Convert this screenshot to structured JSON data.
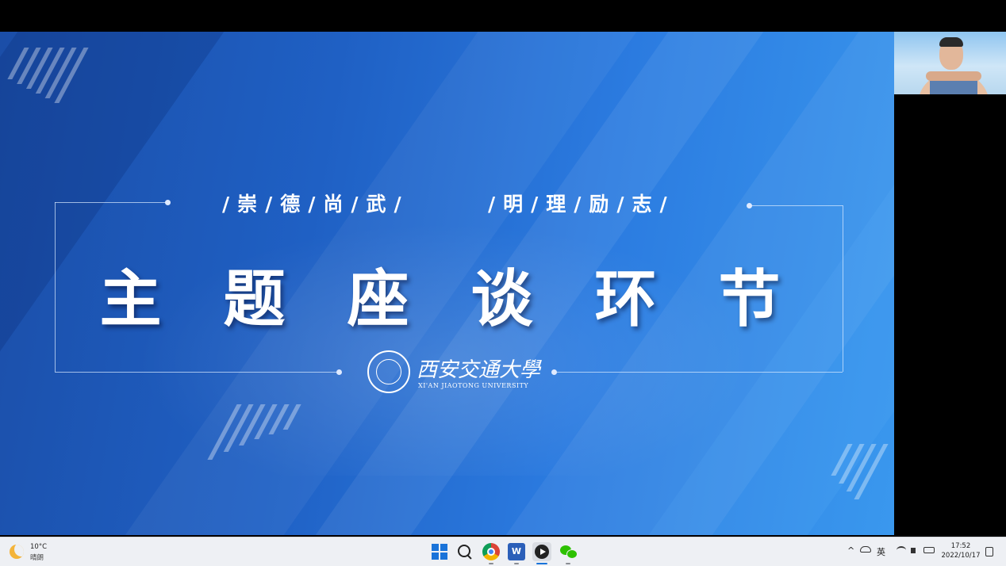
{
  "slide": {
    "slogan_left": "/崇/德/尚/武/",
    "slogan_right": "/明/理/励/志/",
    "main_title": "主题座谈环节",
    "logo_cn": "西安交通大學",
    "logo_en": "XI'AN JIAOTONG UNIVERSITY"
  },
  "taskbar": {
    "weather_temp": "10°C",
    "weather_cond": "晴朗",
    "word_label": "W",
    "tray_chevron": "^",
    "tray_lang": "英",
    "clock_time": "17:52",
    "clock_date": "2022/10/17"
  },
  "colors": {
    "slide_accent": "#1f60c4",
    "taskbar_bg": "#eef0f4",
    "start_blue": "#1a73d9"
  }
}
